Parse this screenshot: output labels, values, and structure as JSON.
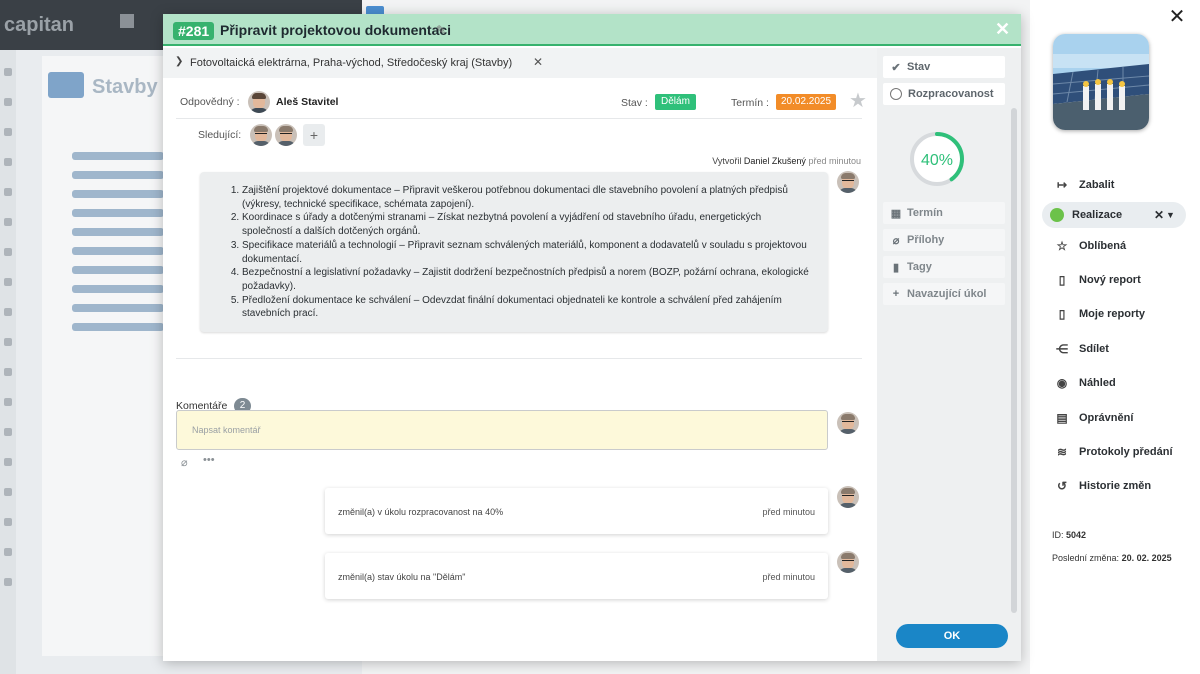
{
  "background": {
    "logo": "capitan",
    "panel_title": "Stavby"
  },
  "modal": {
    "number": "#281",
    "title": "Připravit projektovou dokumentaci",
    "breadcrumb": "Fotovoltaická elektrárna, Praha-východ, Středočeský kraj (Stavby)",
    "responsible_label": "Odpovědný :",
    "responsible_name": "Aleš Stavitel",
    "state_label": "Stav :",
    "state_value": "Dělám",
    "deadline_label": "Termín :",
    "deadline_value": "20.02.2025",
    "followers_label": "Sledující:",
    "created_label": "Vytvořil",
    "created_by": "Daniel Zkušený",
    "created_time": "před minutou",
    "description_items": [
      "Zajištění projektové dokumentace – Připravit veškerou potřebnou dokumentaci dle stavebního povolení a platných předpisů (výkresy, technické specifikace, schémata zapojení).",
      "Koordinace s úřady a dotčenými stranami – Získat nezbytná povolení a vyjádření od stavebního úřadu, energetických společností a dalších dotčených orgánů.",
      "Specifikace materiálů a technologií – Připravit seznam schválených materiálů, komponent a dodavatelů v souladu s projektovou dokumentací.",
      "Bezpečnostní a legislativní požadavky – Zajistit dodržení bezpečnostních předpisů a norem (BOZP, požární ochrana, ekologické požadavky).",
      "Předložení dokumentace ke schválení – Odevzdat finální dokumentaci objednateli ke kontrole a schválení před zahájením stavebních prací."
    ],
    "comments_label": "Komentáře",
    "comments_count": "2",
    "comment_placeholder": "Napsat komentář",
    "log": [
      {
        "text": "změnil(a) v úkolu rozpracovanost na 40%",
        "time": "před minutou"
      },
      {
        "text": "změnil(a) stav úkolu na \"Dělám\"",
        "time": "před minutou"
      }
    ],
    "side_buttons": {
      "stav": "Stav",
      "rozpracovanost": "Rozpracovanost",
      "termin": "Termín",
      "prilohy": "Přílohy",
      "tagy": "Tagy",
      "navazujici": "Navazující úkol"
    },
    "progress_percent": 40,
    "progress_text": "40%",
    "ok_label": "OK",
    "colors": {
      "header_bg": "#b3e3c8",
      "accent_green": "#37b26e",
      "state_badge": "#2fc07a",
      "deadline_badge": "#f28c28",
      "progress": "#2fc07a",
      "ok_button": "#1a86c7"
    }
  },
  "sidebar": {
    "items": [
      {
        "label": "Zabalit",
        "icon": "collapse-icon"
      },
      {
        "label": "Oblíbená",
        "icon": "star-icon"
      },
      {
        "label": "Nový report",
        "icon": "document-icon"
      },
      {
        "label": "Moje reporty",
        "icon": "document-icon"
      },
      {
        "label": "Sdílet",
        "icon": "share-icon"
      },
      {
        "label": "Náhled",
        "icon": "eye-icon"
      },
      {
        "label": "Oprávnění",
        "icon": "id-card-icon"
      },
      {
        "label": "Protokoly předání",
        "icon": "protocol-icon"
      },
      {
        "label": "Historie změn",
        "icon": "history-icon"
      }
    ],
    "phase": "Realizace",
    "id_label": "ID:",
    "id_value": "5042",
    "last_change_label": "Poslední změna:",
    "last_change_value": "20. 02. 2025"
  }
}
